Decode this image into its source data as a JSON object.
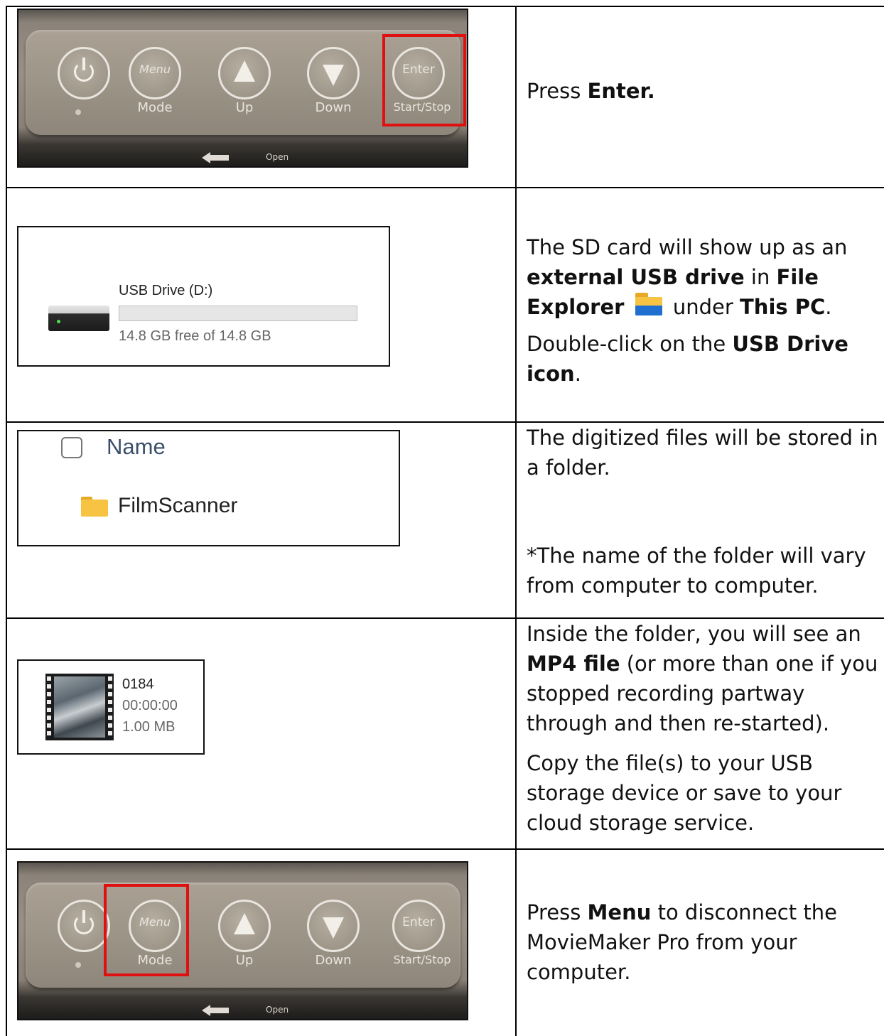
{
  "rows": [
    {
      "panel": {
        "buttons": {
          "menu_label": "Menu",
          "mode_label": "Mode",
          "up_label": "Up",
          "down_label": "Down",
          "enter_label": "Enter",
          "startstop_label": "Start/Stop",
          "open_label": "Open"
        },
        "highlighted_button": "enter"
      },
      "text": {
        "prefix": "Press ",
        "bold": "Enter."
      }
    },
    {
      "drive": {
        "name": "USB Drive (D:)",
        "free_text": "14.8 GB free of 14.8 GB",
        "used_fraction": 0.0
      },
      "text": {
        "p1_a": "The SD card will show up as an ",
        "p1_b": "external USB drive",
        "p1_c": " in ",
        "p1_d": "File Explorer",
        "p1_e": " under ",
        "p1_f": "This PC",
        "p1_g": ".",
        "p2_a": "Double-click on the ",
        "p2_b": "USB Drive icon",
        "p2_c": "."
      }
    },
    {
      "folder_view": {
        "column_header": "Name",
        "folder_name": "FilmScanner"
      },
      "text": {
        "p1": "The digitized files will be stored in a folder.",
        "p2": "*The name of the folder will vary from computer to computer."
      }
    },
    {
      "file": {
        "name": "0184",
        "duration": "00:00:00",
        "size": "1.00 MB"
      },
      "text": {
        "p1_a": "Inside the folder, you will see an ",
        "p1_b": "MP4 file",
        "p1_c": " (or more than one if you stopped recording partway through and then re-started).",
        "p2": "Copy the file(s) to your USB storage device or save to your cloud storage service."
      }
    },
    {
      "panel": {
        "buttons": {
          "menu_label": "Menu",
          "mode_label": "Mode",
          "up_label": "Up",
          "down_label": "Down",
          "enter_label": "Enter",
          "startstop_label": "Start/Stop",
          "open_label": "Open"
        },
        "highlighted_button": "menu"
      },
      "text": {
        "prefix": "Press ",
        "bold": "Menu",
        "suffix": " to disconnect the MovieMaker Pro from your computer."
      }
    }
  ],
  "colors": {
    "highlight": "#e01010",
    "folder": "#f6c342",
    "explorer_blue": "#1f6fd1"
  },
  "icons": [
    "power-icon",
    "up-arrow-icon",
    "down-arrow-icon",
    "hard-drive-icon",
    "checkbox-icon",
    "folder-icon",
    "file-explorer-icon",
    "video-thumbnail-icon"
  ]
}
